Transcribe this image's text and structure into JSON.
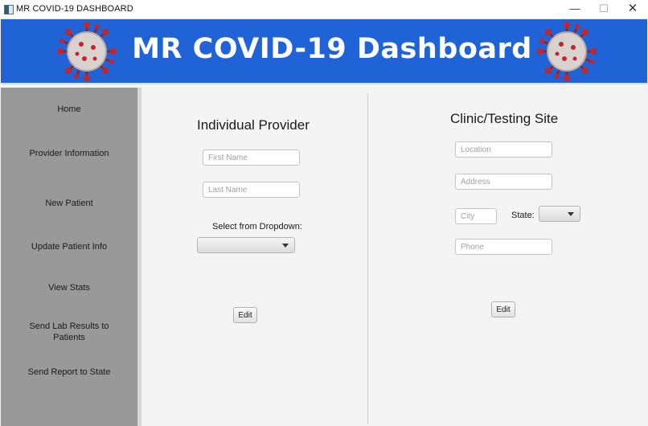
{
  "window": {
    "title": "MR COVID-19 DASHBOARD",
    "minimize": "—",
    "maximize": "☐",
    "close": "✕"
  },
  "header": {
    "title": "MR COVID-19 Dashboard",
    "background_color": "#1f63d6"
  },
  "sidebar": {
    "background_color": "#999999",
    "items": [
      {
        "label": "Home"
      },
      {
        "label": "Provider Information"
      },
      {
        "label": "New Patient"
      },
      {
        "label": "Update Patient Info"
      },
      {
        "label": "View Stats"
      },
      {
        "label": "Send Lab Results to Patients"
      },
      {
        "label": "Send Report to State"
      }
    ]
  },
  "provider": {
    "title": "Individual Provider",
    "first_name_placeholder": "First Name",
    "last_name_placeholder": "Last Name",
    "dropdown_label": "Select from Dropdown:",
    "dropdown_value": "",
    "edit_label": "Edit"
  },
  "clinic": {
    "title": "Clinic/Testing Site",
    "location_placeholder": "Location",
    "address_placeholder": "Address",
    "city_placeholder": "City",
    "state_label": "State:",
    "state_value": "",
    "phone_placeholder": "Phone",
    "edit_label": "Edit"
  }
}
